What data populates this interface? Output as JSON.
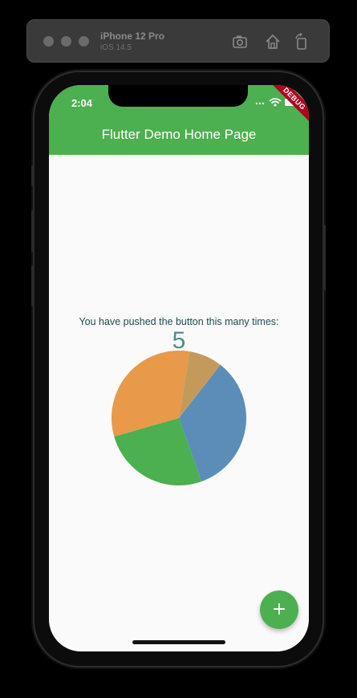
{
  "simulator": {
    "device_name": "iPhone 12 Pro",
    "os_version": "iOS 14.5",
    "toolbar_icons": [
      "screenshot-icon",
      "home-icon",
      "rotate-icon"
    ]
  },
  "status_bar": {
    "time": "2:04"
  },
  "app_bar": {
    "title": "Flutter Demo Home Page",
    "color": "#4caf50"
  },
  "debug_banner": "DEBUG",
  "body": {
    "counter_label": "You have pushed the button this many times:",
    "counter_value": "5"
  },
  "chart_data": {
    "type": "pie",
    "slices": [
      {
        "color": "#5b8db8",
        "fraction": 0.34
      },
      {
        "color": "#4caf50",
        "fraction": 0.26
      },
      {
        "color": "#e8994a",
        "fraction": 0.32
      },
      {
        "color": "#c49a5a",
        "fraction": 0.08
      }
    ]
  },
  "fab": {
    "icon": "+",
    "color": "#4caf50"
  }
}
